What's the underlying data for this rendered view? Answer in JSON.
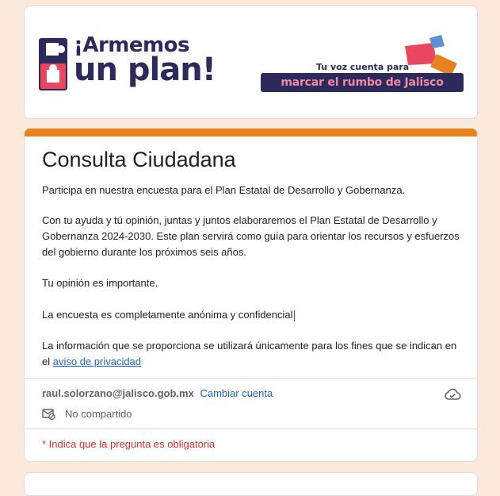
{
  "banner": {
    "logo_line1": "¡Armemos",
    "logo_line2": "un plan!",
    "tagline_small": "Tu voz cuenta para",
    "tagline_big": "marcar el rumbo de Jalisco",
    "brand_navy": "#2b2a5a",
    "brand_pink": "#e8475f",
    "brand_orange": "#e8821e",
    "brand_blue": "#5b8fd6"
  },
  "form": {
    "accent_color": "#e8821e",
    "title": "Consulta Ciudadana",
    "p1": "Participa en nuestra encuesta para el Plan Estatal de Desarrollo y Gobernanza.",
    "p2": "Con tu ayuda y tú opinión, juntas y juntos elaboraremos el Plan Estatal de Desarrollo y Gobernanza 2024-2030. Este plan servirá como guía para orientar los recursos y esfuerzos del gobierno durante los próximos seis años.",
    "p3": "Tu opinión es importante.",
    "p4": "La encuesta es completamente anónima y confidencial",
    "p5_prefix": "La información que se proporciona se utilizará únicamente para los fines que se indican en el ",
    "p5_link": "aviso de privacidad",
    "account_email": "raul.solorzano@jalisco.gob.mx",
    "switch_account": "Cambiar cuenta",
    "not_shared": "No compartido",
    "required_note": "* Indica que la pregunta es obligatoria",
    "icons": [
      "cloud-check-icon",
      "mail-off-icon"
    ]
  }
}
